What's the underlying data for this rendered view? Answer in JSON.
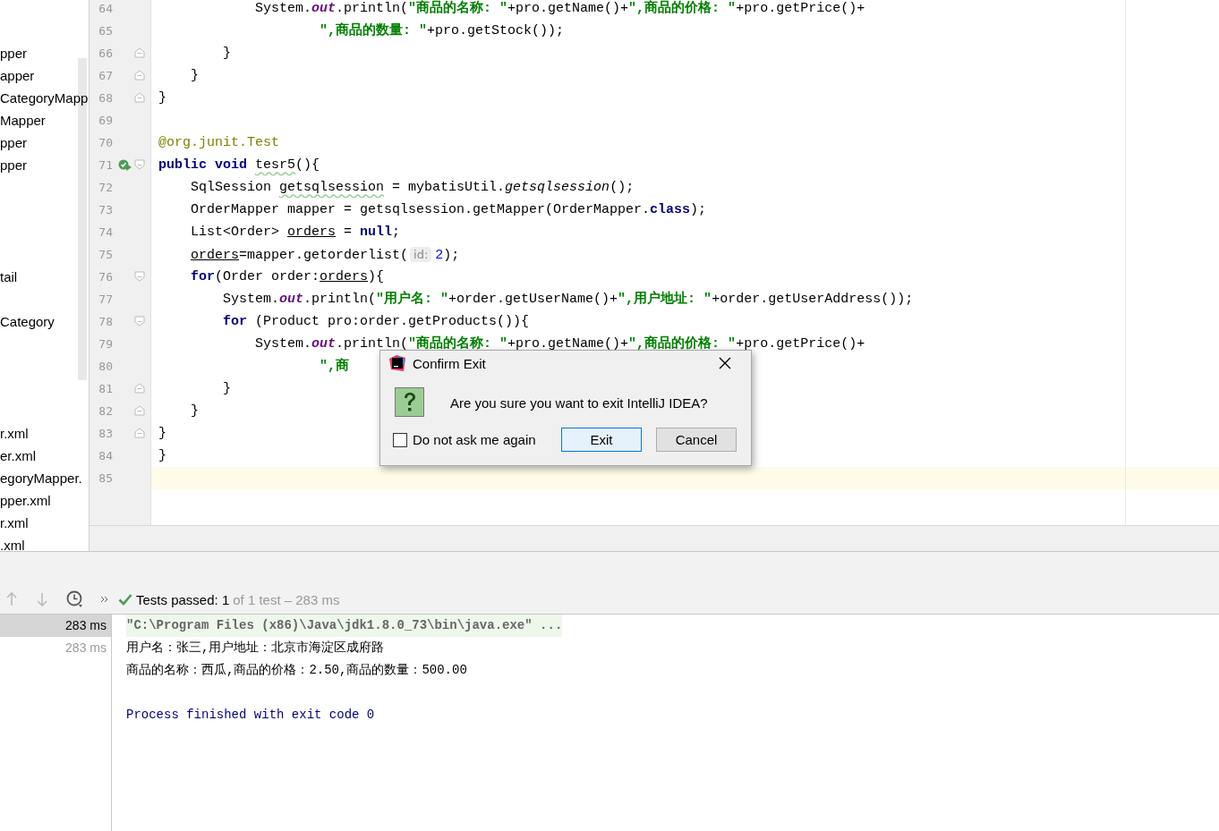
{
  "project_tree": {
    "groups": [
      {
        "items": [
          "pper",
          "apper",
          "CategoryMapp",
          "Mapper",
          "pper",
          "pper"
        ]
      },
      {
        "items": [
          "tail"
        ]
      },
      {
        "items": [
          "Category"
        ]
      },
      {
        "items": [
          "r.xml",
          "er.xml",
          "egoryMapper.",
          "pper.xml",
          "r.xml",
          ".xml"
        ]
      }
    ]
  },
  "editor": {
    "lines": [
      {
        "number": "64",
        "fold_start": false,
        "fold_end": false,
        "run": false,
        "current": false,
        "tokens": [
          {
            "kind": "plain",
            "text": "            System."
          },
          {
            "kind": "field",
            "text": "out"
          },
          {
            "kind": "plain",
            "text": ".println("
          },
          {
            "kind": "str",
            "text": "\"商品的名称: \""
          },
          {
            "kind": "plain",
            "text": "+pro.getName()+"
          },
          {
            "kind": "str",
            "text": "\",商品的价格: \""
          },
          {
            "kind": "plain",
            "text": "+pro.getPrice()+"
          }
        ]
      },
      {
        "number": "65",
        "fold_start": false,
        "fold_end": false,
        "run": false,
        "current": false,
        "tokens": [
          {
            "kind": "str",
            "text": "                    \",商品的数量: \""
          },
          {
            "kind": "plain",
            "text": "+pro.getStock());"
          }
        ]
      },
      {
        "number": "66",
        "fold_start": false,
        "fold_end": true,
        "run": false,
        "current": false,
        "tokens": [
          {
            "kind": "plain",
            "text": "        }"
          }
        ]
      },
      {
        "number": "67",
        "fold_start": false,
        "fold_end": true,
        "run": false,
        "current": false,
        "tokens": [
          {
            "kind": "plain",
            "text": "    }"
          }
        ]
      },
      {
        "number": "68",
        "fold_start": false,
        "fold_end": true,
        "run": false,
        "current": false,
        "tokens": [
          {
            "kind": "plain",
            "text": "}"
          }
        ]
      },
      {
        "number": "69",
        "fold_start": false,
        "fold_end": false,
        "run": false,
        "current": false
      },
      {
        "number": "70",
        "fold_start": false,
        "fold_end": false,
        "run": false,
        "current": false,
        "tokens": [
          {
            "kind": "ann",
            "text": "@org.junit."
          },
          {
            "kind": "type",
            "text": "Test"
          }
        ]
      },
      {
        "number": "71",
        "fold_start": true,
        "fold_end": false,
        "run": true,
        "current": false,
        "tokens": [
          {
            "kind": "kw",
            "text": "public void "
          },
          {
            "kind": "warn",
            "text": "tesr5"
          },
          {
            "kind": "plain",
            "text": "(){"
          }
        ]
      },
      {
        "number": "72",
        "fold_start": false,
        "fold_end": false,
        "run": false,
        "current": false,
        "tokens": [
          {
            "kind": "plain",
            "text": "    SqlSession "
          },
          {
            "kind": "warn",
            "text": "getsqlsession"
          },
          {
            "kind": "plain",
            "text": " = mybatisUtil."
          },
          {
            "kind": "italic",
            "text": "getsqlsession"
          },
          {
            "kind": "plain",
            "text": "();"
          }
        ]
      },
      {
        "number": "73",
        "fold_start": false,
        "fold_end": false,
        "run": false,
        "current": false,
        "tokens": [
          {
            "kind": "plain",
            "text": "    OrderMapper mapper = getsqlsession.getMapper(OrderMapper."
          },
          {
            "kind": "kw",
            "text": "class"
          },
          {
            "kind": "plain",
            "text": ");"
          }
        ]
      },
      {
        "number": "74",
        "fold_start": false,
        "fold_end": false,
        "run": false,
        "current": false,
        "tokens": [
          {
            "kind": "plain",
            "text": "    List<Order> "
          },
          {
            "kind": "under",
            "text": "orders"
          },
          {
            "kind": "plain",
            "text": " = "
          },
          {
            "kind": "null",
            "text": "null"
          },
          {
            "kind": "plain",
            "text": ";"
          }
        ]
      },
      {
        "number": "75",
        "fold_start": false,
        "fold_end": false,
        "run": false,
        "current": false,
        "tokens": [
          {
            "kind": "under",
            "text": "    orders"
          },
          {
            "kind": "plain",
            "text": "=mapper.getorderlist("
          },
          {
            "kind": "hint",
            "text": "id:"
          },
          {
            "kind": "num",
            "text": "2"
          },
          {
            "kind": "plain",
            "text": ");"
          }
        ]
      },
      {
        "number": "76",
        "fold_start": true,
        "fold_end": false,
        "run": false,
        "current": false,
        "tokens": [
          {
            "kind": "kw",
            "text": "    for"
          },
          {
            "kind": "plain",
            "text": "(Order order:"
          },
          {
            "kind": "under",
            "text": "orders"
          },
          {
            "kind": "plain",
            "text": "){"
          }
        ]
      },
      {
        "number": "77",
        "fold_start": false,
        "fold_end": false,
        "run": false,
        "current": false,
        "tokens": [
          {
            "kind": "plain",
            "text": "        System."
          },
          {
            "kind": "field",
            "text": "out"
          },
          {
            "kind": "plain",
            "text": ".println("
          },
          {
            "kind": "str",
            "text": "\"用户名: \""
          },
          {
            "kind": "plain",
            "text": "+order.getUserName()+"
          },
          {
            "kind": "str",
            "text": "\",用户地址: \""
          },
          {
            "kind": "plain",
            "text": "+order.getUserAddress());"
          }
        ]
      },
      {
        "number": "78",
        "fold_start": true,
        "fold_end": false,
        "run": false,
        "current": false,
        "tokens": [
          {
            "kind": "kw",
            "text": "        for "
          },
          {
            "kind": "plain",
            "text": "(Product pro:order.getProducts()){"
          }
        ]
      },
      {
        "number": "79",
        "fold_start": false,
        "fold_end": false,
        "run": false,
        "current": false,
        "tokens": [
          {
            "kind": "plain",
            "text": "            System."
          },
          {
            "kind": "field",
            "text": "out"
          },
          {
            "kind": "plain",
            "text": ".println("
          },
          {
            "kind": "str",
            "text": "\"商品的名称: \""
          },
          {
            "kind": "plain",
            "text": "+pro.getName()+"
          },
          {
            "kind": "str",
            "text": "\",商品的价格: \""
          },
          {
            "kind": "plain",
            "text": "+pro.getPrice()+"
          }
        ]
      },
      {
        "number": "80",
        "fold_start": false,
        "fold_end": false,
        "run": false,
        "current": false,
        "tokens": [
          {
            "kind": "str",
            "text": "                    \",商"
          }
        ]
      },
      {
        "number": "81",
        "fold_start": false,
        "fold_end": true,
        "run": false,
        "current": false,
        "tokens": [
          {
            "kind": "plain",
            "text": "        }"
          }
        ]
      },
      {
        "number": "82",
        "fold_start": false,
        "fold_end": true,
        "run": false,
        "current": false,
        "tokens": [
          {
            "kind": "plain",
            "text": "    }"
          }
        ]
      },
      {
        "number": "83",
        "fold_start": false,
        "fold_end": true,
        "run": false,
        "current": false,
        "tokens": [
          {
            "kind": "plain",
            "text": "}"
          }
        ]
      },
      {
        "number": "84",
        "fold_start": false,
        "fold_end": false,
        "run": false,
        "current": false,
        "tokens": [
          {
            "kind": "plain",
            "text": "}"
          }
        ]
      },
      {
        "number": "85",
        "fold_start": false,
        "fold_end": false,
        "run": false,
        "current": true
      }
    ]
  },
  "dialog": {
    "title": "Confirm Exit",
    "message": "Are you sure you want to exit IntelliJ IDEA?",
    "checkbox": {
      "label": "Do not ask me again",
      "checked": false
    },
    "buttons": [
      {
        "label": "Exit",
        "selected": true
      },
      {
        "label": "Cancel",
        "selected": false
      }
    ]
  },
  "run_panel": {
    "status": {
      "passed": "Tests passed: 1",
      "rest": "of 1 test – 283 ms"
    },
    "tree": [
      {
        "label": "283 ms",
        "selected": true
      },
      {
        "label": "283 ms",
        "selected": false
      }
    ],
    "console": [
      {
        "kind": "command",
        "text": "\"C:\\Program Files (x86)\\Java\\jdk1.8.0_73\\bin\\java.exe\" ..."
      },
      {
        "kind": "output",
        "text": "用户名：张三,用户地址：北京市海淀区成府路"
      },
      {
        "kind": "output",
        "text": "商品的名称：西瓜,商品的价格：2.50,商品的数量：500.00"
      },
      {
        "kind": "exit",
        "text": "Process finished with exit code 0"
      }
    ]
  }
}
